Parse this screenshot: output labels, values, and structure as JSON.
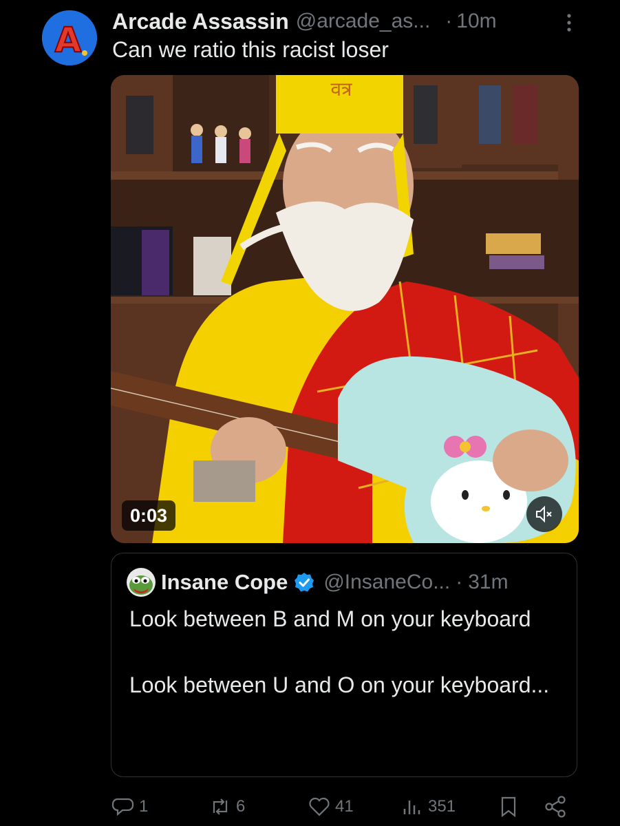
{
  "post": {
    "display_name": "Arcade Assassin",
    "handle": "@arcade_as...",
    "separator": "·",
    "time": "10m",
    "text": "Can we ratio this racist loser",
    "avatar_letter": "A",
    "media": {
      "duration": "0:03",
      "overlay_text": "वत्र"
    }
  },
  "quote": {
    "display_name": "Insane Cope",
    "handle": "@InsaneCo...",
    "separator": "·",
    "time": "31m",
    "lines": [
      "Look between B and M on your keyboard",
      "Look between U and O on your keyboard..."
    ]
  },
  "actions": {
    "replies": "1",
    "reposts": "6",
    "likes": "41",
    "views": "351"
  },
  "colors": {
    "background": "#000000",
    "text": "#e7e9ea",
    "muted": "#71767b",
    "verified": "#1d9bf0",
    "border": "#2f3336"
  },
  "icons": [
    "more-icon",
    "mute-icon",
    "verified-icon",
    "reply-icon",
    "repost-icon",
    "like-icon",
    "views-icon",
    "bookmark-icon",
    "share-icon"
  ]
}
